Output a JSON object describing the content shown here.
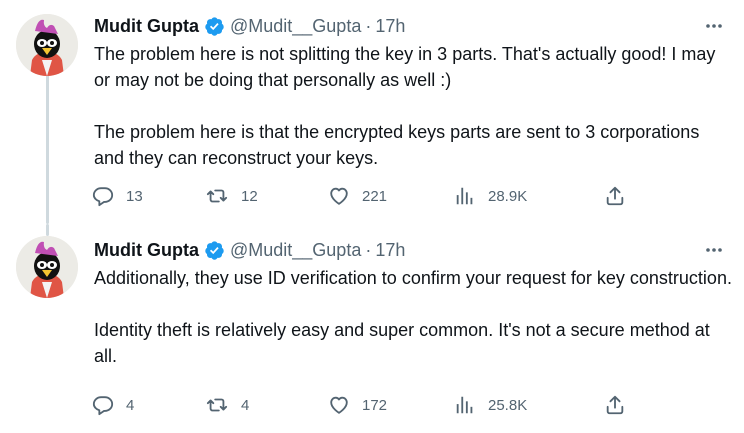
{
  "colors": {
    "text": "#0f1419",
    "secondary": "#536471",
    "verified": "#1d9bf0",
    "thread_line": "#cfd9de"
  },
  "tweets": [
    {
      "author": {
        "display_name": "Mudit Gupta",
        "handle": "@Mudit__Gupta",
        "avatar_icon": "penguin-avatar-icon",
        "verified": true
      },
      "separator": "·",
      "time": "17h",
      "paragraphs": [
        "The problem here is not splitting the key in 3 parts. That's actually good! I may or may not be doing that personally as well :)",
        "The problem here is that the encrypted keys parts are sent to 3 corporations and they can reconstruct your keys."
      ],
      "stats": {
        "replies": "13",
        "retweets": "12",
        "likes": "221",
        "views": "28.9K"
      }
    },
    {
      "author": {
        "display_name": "Mudit Gupta",
        "handle": "@Mudit__Gupta",
        "avatar_icon": "penguin-avatar-icon",
        "verified": true
      },
      "separator": "·",
      "time": "17h",
      "paragraphs": [
        "Additionally, they use ID verification to confirm your request for key construction.",
        "Identity theft is relatively easy and super common. It's not a secure method at all."
      ],
      "stats": {
        "replies": "4",
        "retweets": "4",
        "likes": "172",
        "views": "25.8K"
      }
    }
  ]
}
